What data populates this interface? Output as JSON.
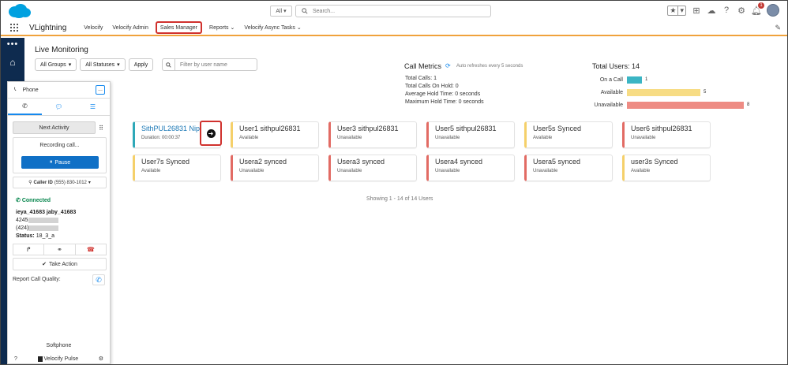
{
  "search": {
    "scope": "All",
    "placeholder": "Search..."
  },
  "header": {
    "notification_count": "1"
  },
  "nav": {
    "app_name": "VLightning",
    "items": [
      {
        "label": "Velocify",
        "dropdown": false,
        "active": false
      },
      {
        "label": "Velocify Admin",
        "dropdown": false,
        "active": false
      },
      {
        "label": "Sales Manager",
        "dropdown": false,
        "active": true
      },
      {
        "label": "Reports",
        "dropdown": true,
        "active": false
      },
      {
        "label": "Velocify Async Tasks",
        "dropdown": true,
        "active": false
      }
    ]
  },
  "live_monitoring": {
    "title": "Live Monitoring",
    "groups_label": "All Groups",
    "statuses_label": "All Statuses",
    "apply_label": "Apply",
    "filter_placeholder": "Filter by user name",
    "showing": "Showing 1 - 14 of 14 Users"
  },
  "call_metrics": {
    "title": "Call Metrics",
    "auto_refresh": "Auto refreshes every 5 seconds",
    "lines": [
      "Total Calls: 1",
      "Total Calls On Hold: 0",
      "Average Hold Time: 0 seconds",
      "Maximum Hold Time: 0 seconds"
    ]
  },
  "total_users": {
    "title": "Total Users: 14",
    "rows": [
      {
        "label": "On a Call",
        "value": 1,
        "color": "#3bb5c4"
      },
      {
        "label": "Available",
        "value": 5,
        "color": "#f7dc84"
      },
      {
        "label": "Unavailable",
        "value": 8,
        "color": "#ee8c84"
      }
    ]
  },
  "cards": [
    {
      "name": "",
      "status": "",
      "type": "unavail",
      "hidden": true
    },
    {
      "name": "SithPUL26831 Nip",
      "status": "Duration: 00:00:37",
      "type": "oncall"
    },
    {
      "name": "User1 sithpul26831",
      "status": "Available",
      "type": "avail"
    },
    {
      "name": "User3 sithpul26831",
      "status": "Unavailable",
      "type": "unavail"
    },
    {
      "name": "User5 sithpul26831",
      "status": "Unavailable",
      "type": "unavail"
    },
    {
      "name": "User5s Synced",
      "status": "Available",
      "type": "avail"
    },
    {
      "name": "User6 sithpul26831",
      "status": "Unavailable",
      "type": "unavail"
    },
    {
      "name": "",
      "status": "",
      "type": "unavail",
      "hidden": true
    },
    {
      "name": "User7s Synced",
      "status": "Available",
      "type": "avail"
    },
    {
      "name": "Usera2 synced",
      "status": "Unavailable",
      "type": "unavail"
    },
    {
      "name": "Usera3 synced",
      "status": "Unavailable",
      "type": "unavail"
    },
    {
      "name": "Usera4 synced",
      "status": "Unavailable",
      "type": "unavail"
    },
    {
      "name": "Usera5 synced",
      "status": "Unavailable",
      "type": "unavail"
    },
    {
      "name": "user3s Synced",
      "status": "Available",
      "type": "avail"
    }
  ],
  "softphone": {
    "header": "Phone",
    "minimize": "...",
    "next_activity": "Next Activity",
    "recording": "Recording call...",
    "pause": "Pause",
    "caller_id_label": "Caller ID",
    "caller_id_value": "(555) 830-1012",
    "connected": "Connected",
    "contact_name": "ieya_41683 jaby_41683",
    "phone_prefix_1": "4245",
    "phone_prefix_2": "(424)",
    "status": "Status:",
    "status_value": "18_3_a",
    "take_action": "Take Action",
    "report_quality": "Report Call Quality:",
    "footer_title": "Softphone",
    "brand": "Velocify Pulse"
  }
}
